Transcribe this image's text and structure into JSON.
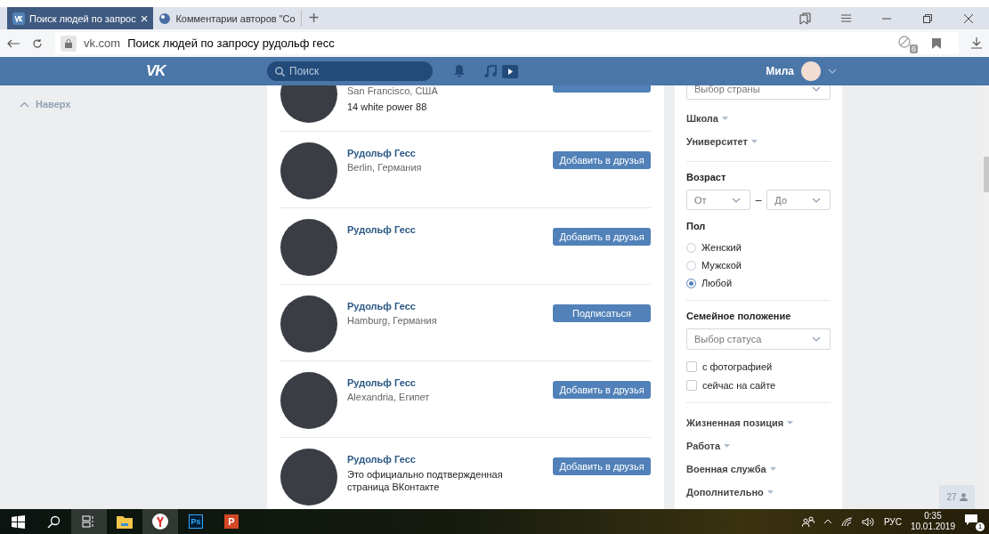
{
  "browser": {
    "tabs": [
      {
        "title": "Поиск людей по запрос",
        "selected": true,
        "close": "×"
      },
      {
        "title": "Комментарии авторов \"Co",
        "selected": false
      }
    ],
    "new_tab": "+",
    "address": {
      "domain": "vk.com",
      "title": "Поиск людей по запросу рудольф гесс",
      "blocked_count": "6"
    }
  },
  "vk_header": {
    "logo": "VK",
    "search_placeholder": "Поиск",
    "user_name": "Мила"
  },
  "sidebar": {
    "back_to_top": "Наверх"
  },
  "people": [
    {
      "location": "San Francisco, США",
      "status": "14 white power 88"
    },
    {
      "name": "Рудольф Гесс",
      "location": "Berlin, Германия",
      "button": "Добавить в друзья"
    },
    {
      "name": "Рудольф Гесс",
      "button": "Добавить в друзья"
    },
    {
      "name": "Рудольф Гесс",
      "location": "Hamburg, Германия",
      "button": "Подписаться"
    },
    {
      "name": "Рудольф Гесс",
      "location": "Alexandria, Египет",
      "button": "Добавить в друзья"
    },
    {
      "name": "Рудольф Гесс",
      "status": "Это официально подтвержденная страница ВКонтакте",
      "button": "Добавить в друзья"
    }
  ],
  "filters": [
    {
      "kind": "select",
      "placeholder": "Выбор страны"
    },
    {
      "kind": "expander",
      "label": "Школа"
    },
    {
      "kind": "expander",
      "label": "Университет"
    },
    {
      "kind": "divider"
    },
    {
      "kind": "heading",
      "label": "Возраст"
    },
    {
      "kind": "range",
      "from": "От",
      "dash": "–",
      "to": "До"
    },
    {
      "kind": "heading",
      "label": "Пол"
    },
    {
      "kind": "radio",
      "label": "Женский",
      "selected": false
    },
    {
      "kind": "radio",
      "label": "Мужской",
      "selected": false
    },
    {
      "kind": "radio",
      "label": "Любой",
      "selected": true
    },
    {
      "kind": "divider"
    },
    {
      "kind": "heading",
      "label": "Семейное положение"
    },
    {
      "kind": "select",
      "placeholder": "Выбор статуса"
    },
    {
      "kind": "checkbox",
      "label": "с фотографией",
      "checked": false
    },
    {
      "kind": "checkbox",
      "label": "сейчас на сайте",
      "checked": false
    },
    {
      "kind": "divider"
    },
    {
      "kind": "expander",
      "label": "Жизненная позиция"
    },
    {
      "kind": "expander",
      "label": "Работа"
    },
    {
      "kind": "expander",
      "label": "Военная служба"
    },
    {
      "kind": "expander",
      "label": "Дополнительно"
    }
  ],
  "online_badge": "27",
  "taskbar": {
    "apps": [
      {
        "kind": "start",
        "active": false
      },
      {
        "kind": "search",
        "active": false
      },
      {
        "kind": "taskview",
        "active": true
      },
      {
        "kind": "folder",
        "active": false
      },
      {
        "kind": "browser",
        "active": true
      },
      {
        "kind": "ps",
        "label": "Ps",
        "active": false
      },
      {
        "kind": "ppt",
        "label": "P",
        "active": false
      }
    ],
    "language": "РУС",
    "time": "0:35",
    "date": "10.01.2019",
    "notifications": "1"
  }
}
